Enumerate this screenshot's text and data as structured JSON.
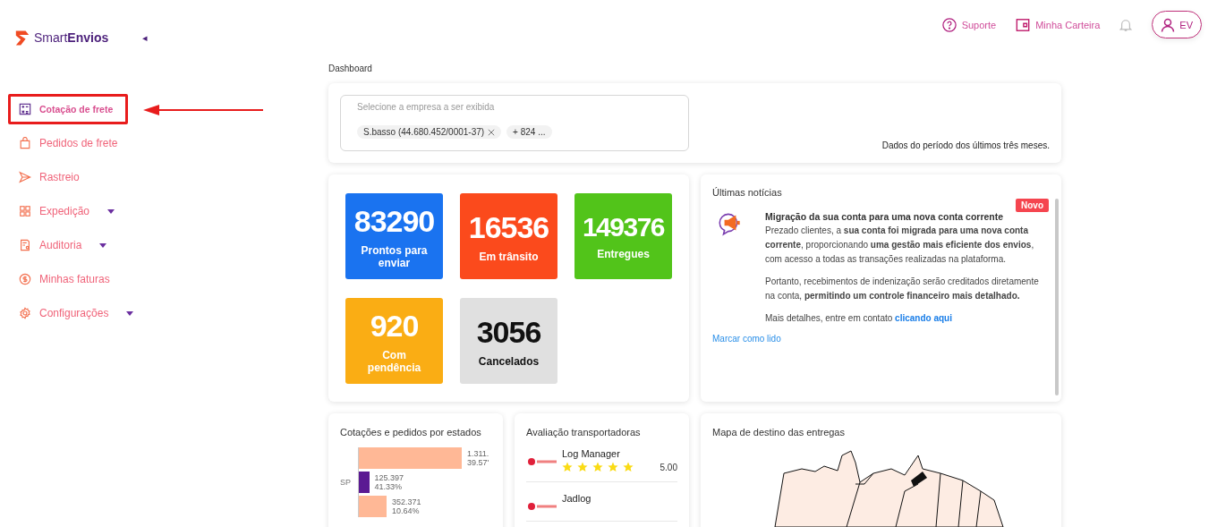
{
  "brand": {
    "name_light": "Smart",
    "name_bold": "Envios",
    "collapse_glyph": "◂"
  },
  "sidebar": {
    "items": [
      {
        "label": "Cotação de frete",
        "highlighted": true,
        "has_submenu": false
      },
      {
        "label": "Pedidos de frete",
        "highlighted": false,
        "has_submenu": false
      },
      {
        "label": "Rastreio",
        "highlighted": false,
        "has_submenu": false
      },
      {
        "label": "Expedição",
        "highlighted": false,
        "has_submenu": true
      },
      {
        "label": "Auditoria",
        "highlighted": false,
        "has_submenu": true
      },
      {
        "label": "Minhas faturas",
        "highlighted": false,
        "has_submenu": false
      },
      {
        "label": "Configurações",
        "highlighted": false,
        "has_submenu": true
      }
    ]
  },
  "topbar": {
    "support": "Suporte",
    "wallet": "Minha Carteira",
    "avatar_initials": "EV"
  },
  "breadcrumb": "Dashboard",
  "filter": {
    "placeholder": "Selecione a empresa a ser exibida",
    "chips": [
      "S.basso (44.680.452/0001-37)",
      "+ 824 ..."
    ],
    "period_note": "Dados do período dos últimos três meses."
  },
  "stats": [
    {
      "value": "83290",
      "label": "Prontos para enviar",
      "color": "#1a73f0"
    },
    {
      "value": "16536",
      "label": "Em trânsito",
      "color": "#fb4a1c"
    },
    {
      "value": "149376",
      "label": "Entregues",
      "color": "#52c41a"
    },
    {
      "value": "920",
      "label": "Com pendência",
      "color": "#faad14"
    },
    {
      "value": "3056",
      "label": "Cancelados",
      "color": "#e0e0e0"
    }
  ],
  "news": {
    "title": "Últimas notícias",
    "badge": "Novo",
    "headline": "Migração da sua conta para uma nova conta corrente",
    "paragraphs": [
      "Prezado clientes, a **sua conta foi migrada para uma nova conta corrente**, proporcionando **uma gestão mais eficiente dos envios**, com acesso a todas as transações realizadas na plataforma.",
      "Portanto, recebimentos de indenização serão creditados diretamente na conta, **permitindo um controle financeiro mais detalhado.**"
    ],
    "contact_text": "Mais detalhes, entre em contato",
    "contact_link": "clicando aqui",
    "mark_read": "Marcar como lido"
  },
  "states_chart": {
    "title": "Cotações e pedidos por estados",
    "category": "SP",
    "bars": [
      {
        "value": "1.311.",
        "share": "39.57'",
        "level": 1.0,
        "color": "#ffb896"
      },
      {
        "value": "125.397",
        "share": "41.33%",
        "level": 0.1,
        "color": "#5b1a93"
      },
      {
        "value": "352.371",
        "share": "10.64%",
        "level": 0.27,
        "color": "#ffb896"
      }
    ]
  },
  "carriers": {
    "title": "Avaliação transportadoras",
    "items": [
      {
        "name": "Log Manager",
        "stars": 5,
        "rating": "5.00"
      },
      {
        "name": "Jadlog"
      }
    ]
  },
  "map": {
    "title": "Mapa de destino das entregas"
  }
}
